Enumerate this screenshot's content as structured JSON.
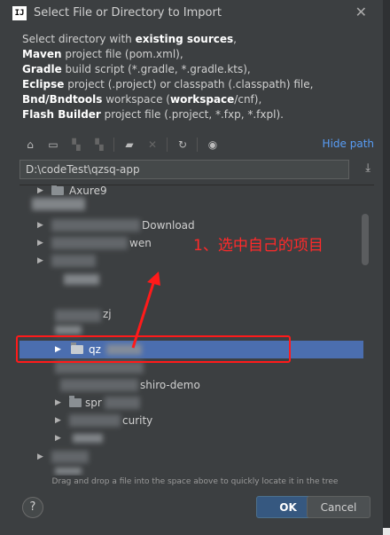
{
  "window": {
    "title": "Select File or Directory to Import",
    "app_icon_text": "IJ"
  },
  "description": {
    "lines": [
      {
        "prefix": "Select directory with ",
        "bold": "existing sources",
        "suffix": ","
      },
      {
        "prefix": "",
        "bold": "Maven",
        "suffix": " project file (pom.xml),"
      },
      {
        "prefix": "",
        "bold": "Gradle",
        "suffix": " build script (*.gradle, *.gradle.kts),"
      },
      {
        "prefix": "",
        "bold": "Eclipse",
        "suffix": " project (.project) or classpath (.classpath) file,"
      },
      {
        "prefix": "",
        "bold": "Bnd/Bndtools",
        "suffix": " workspace (",
        "bold2": "workspace",
        "suffix2": "/cnf),"
      },
      {
        "prefix": "",
        "bold": "Flash Builder",
        "suffix": " project file (.project, *.fxp, *.fxpl)."
      }
    ]
  },
  "toolbar": {
    "hide_path_label": "Hide path",
    "icons": [
      "home-icon",
      "desktop-icon",
      "project-icon",
      "module-icon",
      "new-folder-icon",
      "delete-icon",
      "refresh-icon",
      "show-hidden-icon"
    ]
  },
  "path": {
    "value": "D:\\codeTest\\qzsq-app"
  },
  "tree": {
    "rows": [
      {
        "label": "Axure9"
      },
      {
        "label": ""
      },
      {
        "label": "Download"
      },
      {
        "label": "wen"
      },
      {
        "label": ""
      },
      {
        "label": ""
      },
      {
        "label": "zj"
      },
      {
        "label": ""
      },
      {
        "label": "qz"
      },
      {
        "label": ""
      },
      {
        "label": "shiro-demo"
      },
      {
        "label": "spr"
      },
      {
        "label": "curity"
      },
      {
        "label": ""
      },
      {
        "label": ""
      },
      {
        "label": ""
      }
    ]
  },
  "hint": "Drag and drop a file into the space above to quickly locate it in the tree",
  "buttons": {
    "help": "?",
    "ok": "OK",
    "cancel": "Cancel"
  },
  "annotation": {
    "text": "1、选中自己的项目",
    "color": "#ff1a1a"
  },
  "colors": {
    "selection": "#4b6eaf",
    "link": "#589df6",
    "ok_button": "#365880"
  }
}
